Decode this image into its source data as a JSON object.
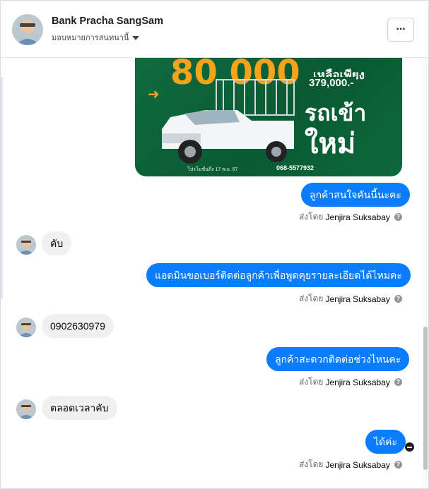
{
  "header": {
    "title": "Bank Pracha SangSam",
    "subtitle": "มอบหมายการสนทนานี้",
    "menu_label": "···"
  },
  "promo": {
    "big_number": "80 000",
    "price_line1": "เหลือเพียง",
    "price_line2": "379,000.-",
    "headline1": "รถเข้า",
    "headline2": "ใหม่",
    "footer_text": "โปรโมชั่นถึง 17 พ.ย. 67",
    "phone": "068-5577932"
  },
  "messages": [
    {
      "side": "out",
      "text": "ลูกค้าสนใจคันนี้นะคะ",
      "sent_by_prefix": "ส่งโดย",
      "sent_by_name": "Jenjira Suksabay"
    },
    {
      "side": "in",
      "text": "คับ"
    },
    {
      "side": "out",
      "text": "แอดมินขอเบอร์ติดต่อลูกค้าเพื่อพูดคุยรายละเอียดได้ไหมคะ",
      "sent_by_prefix": "ส่งโดย",
      "sent_by_name": "Jenjira Suksabay"
    },
    {
      "side": "in",
      "text": "0902630979"
    },
    {
      "side": "out",
      "text": "ลูกค้าสะดวกติดต่อช่วงไหนคะ",
      "sent_by_prefix": "ส่งโดย",
      "sent_by_name": "Jenjira Suksabay"
    },
    {
      "side": "in",
      "text": "ตลอดเวลาคับ"
    },
    {
      "side": "out",
      "text": "ได้ค่ะ",
      "sent_by_prefix": "ส่งโดย",
      "sent_by_name": "Jenjira Suksabay"
    }
  ],
  "icons": {
    "info": "info-icon",
    "seen": "seen-avatar-icon",
    "caret": "chevron-down-icon",
    "menu": "more-options-icon"
  },
  "colors": {
    "outgoing_bubble": "#0a7cff",
    "incoming_bubble": "#f0f0f0",
    "promo_green": "#0f6b3f",
    "promo_orange": "#f7a21b"
  }
}
